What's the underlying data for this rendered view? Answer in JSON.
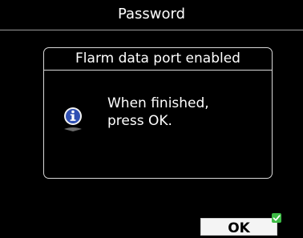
{
  "window": {
    "title": "Password"
  },
  "dialog": {
    "title": "Flarm data port enabled",
    "icon": "info-icon",
    "message_lines": [
      "When finished,",
      "press OK."
    ]
  },
  "buttons": {
    "ok_label": "OK",
    "ok_status_icon": "check-icon"
  },
  "colors": {
    "background": "#000000",
    "text": "#ffffff",
    "icon_blue": "#2f4fb3",
    "check_green": "#3dbb45",
    "button_face": "#f4f4f4"
  }
}
